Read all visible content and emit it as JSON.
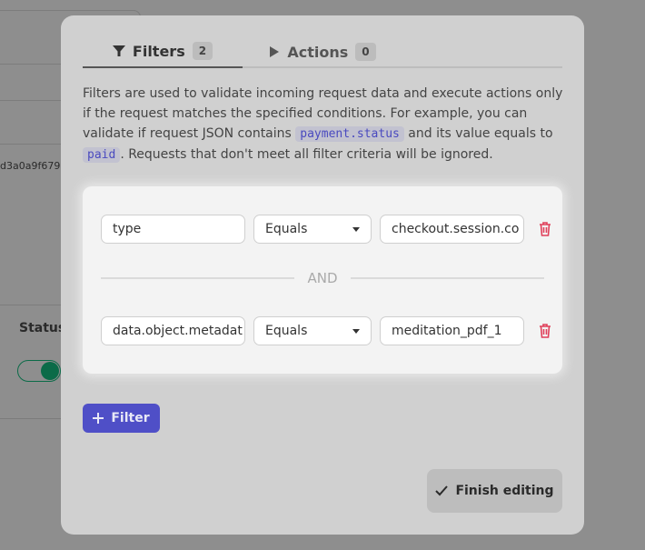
{
  "background": {
    "id_text": "d3a0a9f679",
    "status_label": "Status",
    "status_enabled": true
  },
  "tabs": [
    {
      "label": "Filters",
      "count": "2",
      "icon": "funnel-icon",
      "active": true
    },
    {
      "label": "Actions",
      "count": "0",
      "icon": "play-icon",
      "active": false
    }
  ],
  "description": {
    "part1": "Filters are used to validate incoming request data and execute actions only if the request matches the specified conditions. For example, you can validate if request JSON contains ",
    "code1": "payment.status",
    "part2": " and its value equals to ",
    "code2": "paid",
    "part3": ". Requests that don't meet all filter criteria will be ignored."
  },
  "filters": [
    {
      "field": "type",
      "operator": "Equals",
      "value": "checkout.session.co"
    },
    {
      "field": "data.object.metadat",
      "operator": "Equals",
      "value": "meditation_pdf_1"
    }
  ],
  "joiner": "AND",
  "add_filter_label": "Filter",
  "finish_label": "Finish editing",
  "colors": {
    "accent": "#4f4fc7",
    "delete": "#e0405a",
    "toggle": "#0b6b48"
  }
}
